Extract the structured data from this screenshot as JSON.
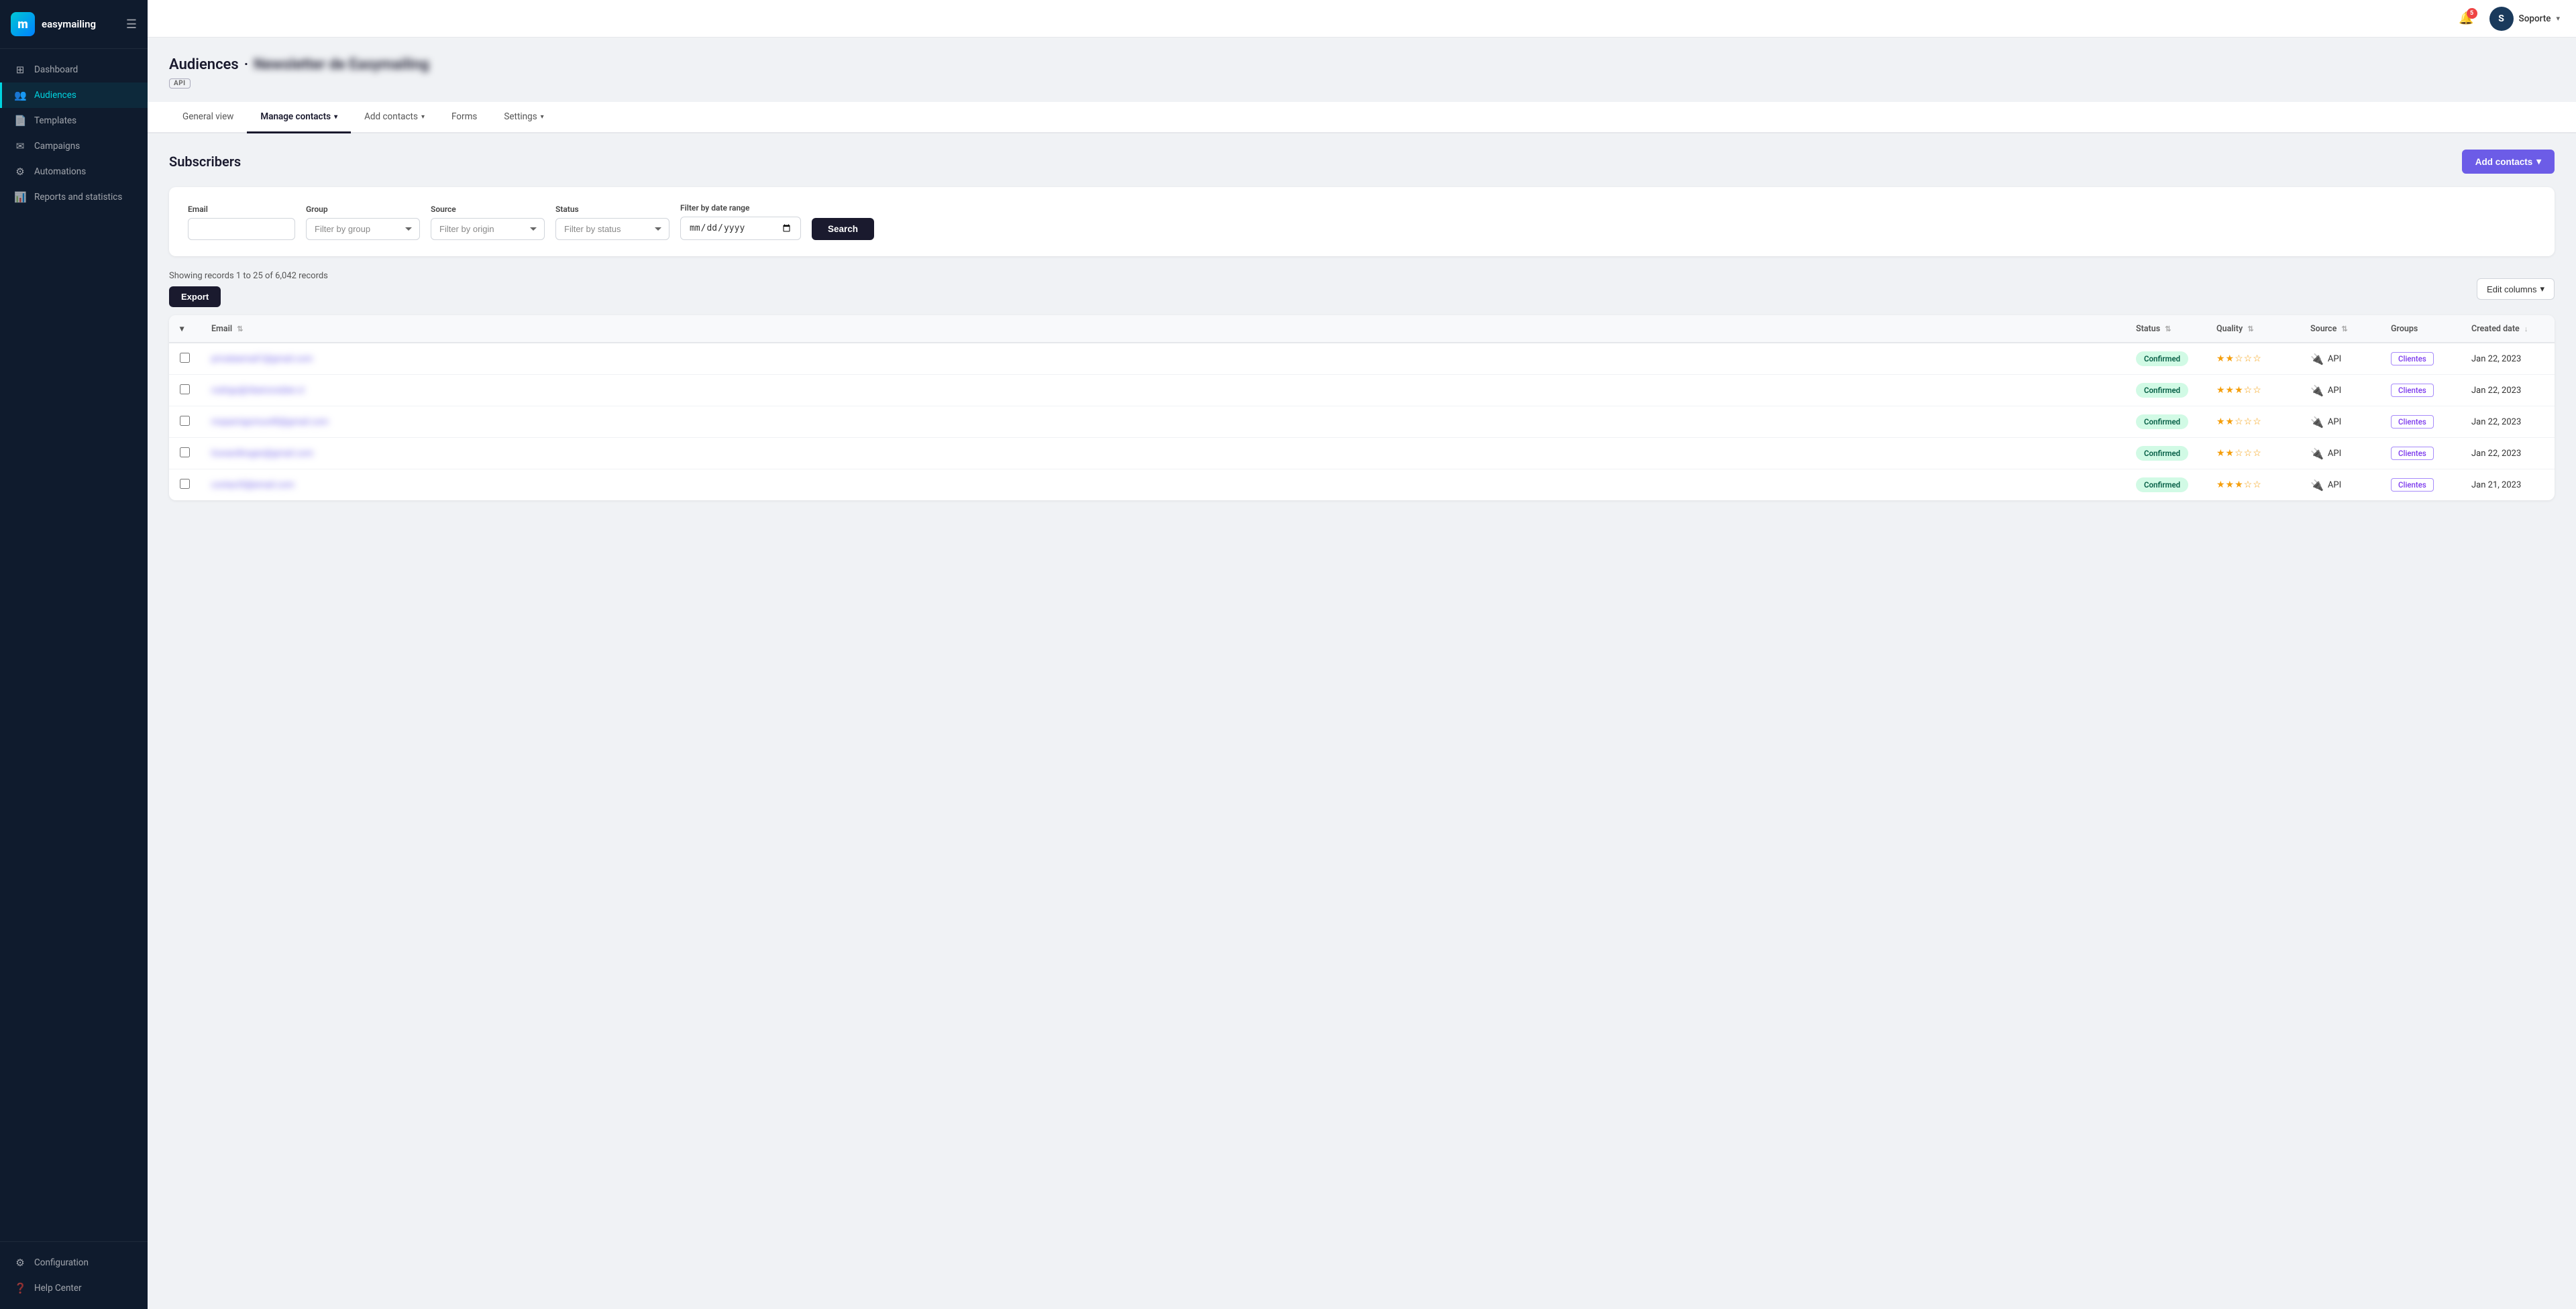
{
  "app": {
    "name": "easymailing",
    "logo_letter": "m"
  },
  "sidebar": {
    "nav_items": [
      {
        "id": "dashboard",
        "label": "Dashboard",
        "icon": "⊞",
        "active": false
      },
      {
        "id": "audiences",
        "label": "Audiences",
        "icon": "👥",
        "active": true
      },
      {
        "id": "templates",
        "label": "Templates",
        "icon": "📄",
        "active": false
      },
      {
        "id": "campaigns",
        "label": "Campaigns",
        "icon": "✉",
        "active": false
      },
      {
        "id": "automations",
        "label": "Automations",
        "icon": "⚙",
        "active": false
      },
      {
        "id": "reports",
        "label": "Reports and statistics",
        "icon": "📊",
        "active": false
      }
    ],
    "footer_items": [
      {
        "id": "configuration",
        "label": "Configuration",
        "icon": "⚙"
      },
      {
        "id": "help",
        "label": "Help Center",
        "icon": "?"
      }
    ]
  },
  "topbar": {
    "notification_count": "5",
    "user_initial": "S",
    "username": "Soporte",
    "chevron": "▾"
  },
  "page": {
    "title": "Audiences",
    "separator": "·",
    "audience_name_blurred": "Newsletter de Easymailing",
    "api_badge": "API"
  },
  "tabs": [
    {
      "id": "general-view",
      "label": "General view",
      "active": false,
      "has_chevron": false
    },
    {
      "id": "manage-contacts",
      "label": "Manage contacts",
      "active": true,
      "has_chevron": true
    },
    {
      "id": "add-contacts",
      "label": "Add contacts",
      "active": false,
      "has_chevron": true
    },
    {
      "id": "forms",
      "label": "Forms",
      "active": false,
      "has_chevron": false
    },
    {
      "id": "settings",
      "label": "Settings",
      "active": false,
      "has_chevron": true
    }
  ],
  "subscribers": {
    "section_title": "Subscribers",
    "add_contacts_label": "Add contacts",
    "records_info": "Showing records 1 to 25 of 6,042 records",
    "export_label": "Export",
    "edit_columns_label": "Edit columns"
  },
  "filters": {
    "email_label": "Email",
    "email_placeholder": "",
    "group_label": "Group",
    "group_placeholder": "Filter by group",
    "source_label": "Source",
    "source_placeholder": "Filter by origin",
    "status_label": "Status",
    "status_placeholder": "Filter by status",
    "date_range_label": "Filter by date range",
    "search_label": "Search"
  },
  "table": {
    "columns": [
      {
        "id": "email",
        "label": "Email",
        "sortable": true
      },
      {
        "id": "status",
        "label": "Status",
        "sortable": true
      },
      {
        "id": "quality",
        "label": "Quality",
        "sortable": true
      },
      {
        "id": "source",
        "label": "Source",
        "sortable": true
      },
      {
        "id": "groups",
        "label": "Groups",
        "sortable": false
      },
      {
        "id": "created_date",
        "label": "Created date",
        "sortable": true
      }
    ],
    "rows": [
      {
        "email_blurred": "privateemail1@gmail.com",
        "status": "Confirmed",
        "quality_filled": 2,
        "quality_total": 5,
        "source": "API",
        "group": "Clientes",
        "created_date": "Jan 22, 2023"
      },
      {
        "email_blurred": "rodrigo@ribeironobler.cl",
        "status": "Confirmed",
        "quality_filled": 3,
        "quality_total": 5,
        "source": "API",
        "group": "Clientes",
        "created_date": "Jan 22, 2023"
      },
      {
        "email_blurred": "mspanrigomux40@gmail.com",
        "status": "Confirmed",
        "quality_filled": 2,
        "quality_total": 5,
        "source": "API",
        "group": "Clientes",
        "created_date": "Jan 22, 2023"
      },
      {
        "email_blurred": "howardhogan@gmail.com",
        "status": "Confirmed",
        "quality_filled": 2,
        "quality_total": 5,
        "source": "API",
        "group": "Clientes",
        "created_date": "Jan 22, 2023"
      },
      {
        "email_blurred": "contact5@email.com",
        "status": "Confirmed",
        "quality_filled": 3,
        "quality_total": 5,
        "source": "API",
        "group": "Clientes",
        "created_date": "Jan 21, 2023"
      }
    ]
  }
}
